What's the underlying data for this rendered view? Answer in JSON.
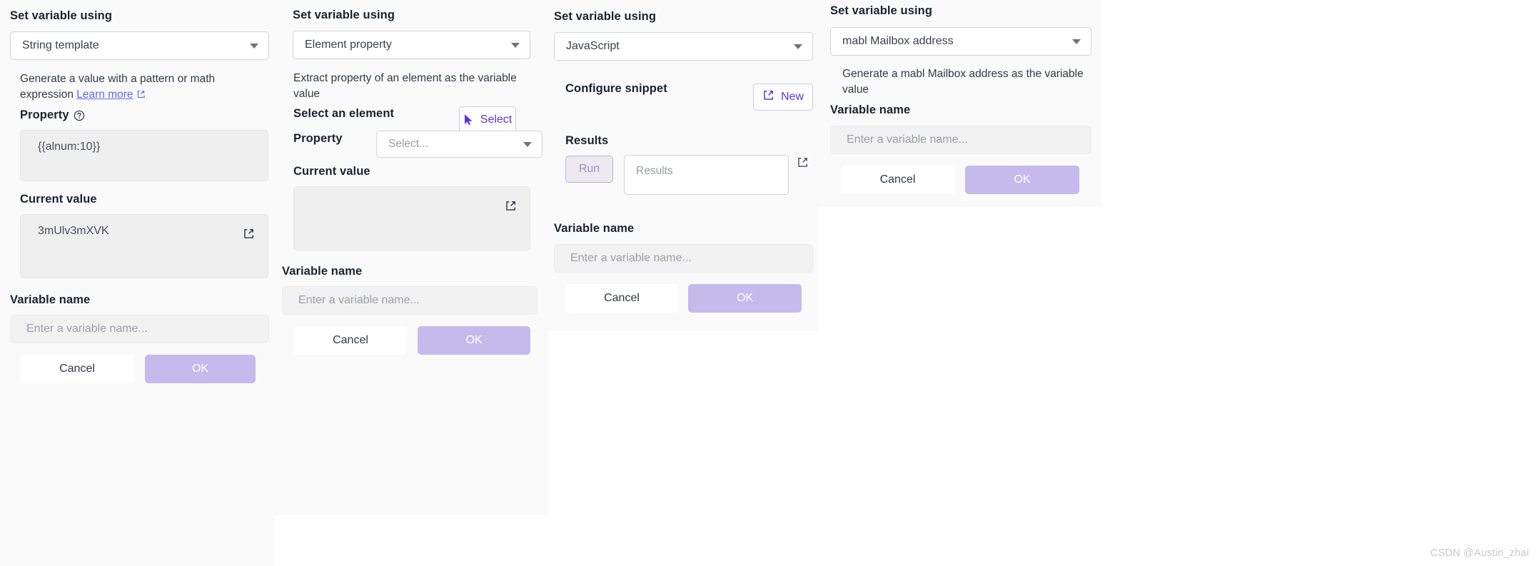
{
  "common": {
    "set_variable_using_label": "Set variable using",
    "variable_name_label": "Variable name",
    "variable_name_placeholder": "Enter a variable name...",
    "current_value_label": "Current value",
    "cancel_label": "Cancel",
    "ok_label": "OK",
    "property_label": "Property",
    "open_in_new_icon": "external-link-icon"
  },
  "colors": {
    "panel_bg": "#fafafa",
    "page_bg": "#ffffff",
    "accent_purple": "#5b35d5",
    "ok_button": "#c4bbec",
    "link_blue": "#5b6af0",
    "readonly_bg": "#efefef",
    "input_bg": "#f2f2f2",
    "border_grey": "#d2d3d8",
    "heading_text": "#1b2034"
  },
  "panels": [
    {
      "id": "string-template",
      "select_label": "Set variable using",
      "selected_option": "String template",
      "description": "Generate a value with a pattern or math expression",
      "learn_more_label": "Learn more",
      "property_label": "Property",
      "property_value": "{{alnum:10}}",
      "current_value_label": "Current value",
      "current_value": "3mUlv3mXVK",
      "variable_name_label": "Variable name",
      "variable_name_placeholder": "Enter a variable name...",
      "cancel_label": "Cancel",
      "ok_label": "OK"
    },
    {
      "id": "element-property",
      "select_label": "Set variable using",
      "selected_option": "Element property",
      "description": "Extract property of an element as the variable value",
      "select_element_label": "Select an element",
      "select_button_label": "Select",
      "property_label": "Property",
      "property_placeholder": "Select...",
      "current_value_label": "Current value",
      "current_value": "",
      "variable_name_label": "Variable name",
      "variable_name_placeholder": "Enter a variable name...",
      "cancel_label": "Cancel",
      "ok_label": "OK"
    },
    {
      "id": "javascript",
      "select_label": "Set variable using",
      "selected_option": "JavaScript",
      "configure_snippet_label": "Configure snippet",
      "new_button_label": "New",
      "results_label": "Results",
      "run_button_label": "Run",
      "results_placeholder": "Results",
      "variable_name_label": "Variable name",
      "variable_name_placeholder": "Enter a variable name...",
      "cancel_label": "Cancel",
      "ok_label": "OK"
    },
    {
      "id": "mabl-mailbox",
      "select_label": "Set variable using",
      "selected_option": "mabl Mailbox address",
      "description": "Generate a mabl Mailbox address as the variable value",
      "variable_name_label": "Variable name",
      "variable_name_placeholder": "Enter a variable name...",
      "cancel_label": "Cancel",
      "ok_label": "OK"
    }
  ],
  "watermark": "CSDN @Austin_zhai"
}
